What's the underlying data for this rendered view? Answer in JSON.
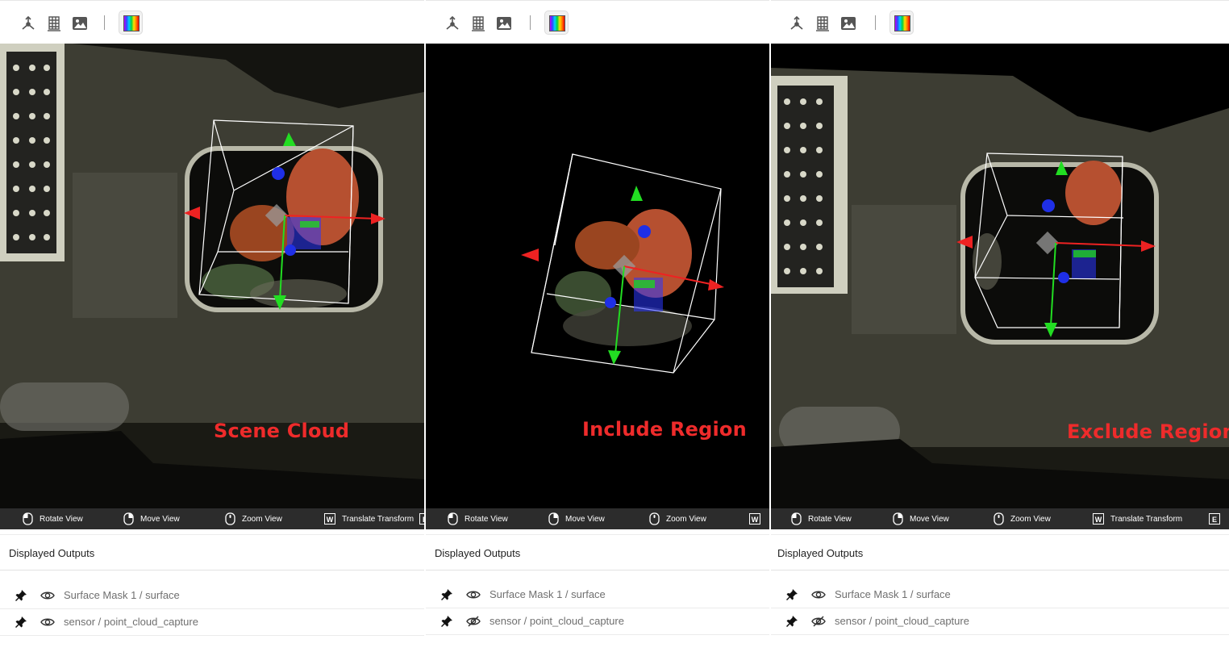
{
  "panels": [
    {
      "id": "scene",
      "overlay_label": "Scene Cloud",
      "toolbar": {
        "icons": [
          "axes-icon",
          "grid-icon",
          "image-icon",
          "colormap-icon"
        ]
      },
      "hints": [
        {
          "icon": "mouse-left-icon",
          "label": "Rotate View"
        },
        {
          "icon": "mouse-right-icon",
          "label": "Move View"
        },
        {
          "icon": "mouse-wheel-icon",
          "label": "Zoom View"
        },
        {
          "key": "W",
          "label": "Translate Transform"
        },
        {
          "key": "E",
          "label": ""
        }
      ],
      "outputs": {
        "title": "Displayed Outputs",
        "rows": [
          {
            "label": "Surface Mask 1 / surface",
            "visible": true
          },
          {
            "label": "sensor / point_cloud_capture",
            "visible": true
          }
        ]
      }
    },
    {
      "id": "include",
      "overlay_label": "Include Region",
      "toolbar": {
        "icons": [
          "axes-icon",
          "grid-icon",
          "image-icon",
          "colormap-icon"
        ]
      },
      "hints": [
        {
          "icon": "mouse-left-icon",
          "label": "Rotate View"
        },
        {
          "icon": "mouse-right-icon",
          "label": "Move View"
        },
        {
          "icon": "mouse-wheel-icon",
          "label": "Zoom View"
        },
        {
          "key": "W",
          "label": ""
        }
      ],
      "outputs": {
        "title": "Displayed Outputs",
        "rows": [
          {
            "label": "Surface Mask 1 / surface",
            "visible": true
          },
          {
            "label": "sensor / point_cloud_capture",
            "visible": false
          }
        ]
      }
    },
    {
      "id": "exclude",
      "overlay_label": "Exclude Region",
      "toolbar": {
        "icons": [
          "axes-icon",
          "grid-icon",
          "image-icon",
          "colormap-icon"
        ]
      },
      "hints": [
        {
          "icon": "mouse-left-icon",
          "label": "Rotate View"
        },
        {
          "icon": "mouse-right-icon",
          "label": "Move View"
        },
        {
          "icon": "mouse-wheel-icon",
          "label": "Zoom View"
        },
        {
          "key": "W",
          "label": "Translate Transform"
        },
        {
          "key": "E",
          "label": ""
        }
      ],
      "outputs": {
        "title": "Displayed Outputs",
        "rows": [
          {
            "label": "Surface Mask 1 / surface",
            "visible": true
          },
          {
            "label": "sensor / point_cloud_capture",
            "visible": false
          }
        ]
      }
    }
  ],
  "colors": {
    "overlay_label": "#ee2b2b",
    "viewport_bg": "#000000",
    "hintbar_bg": "#2c2c2c",
    "gizmo_x": "#ee2222",
    "gizmo_y": "#22dd22",
    "gizmo_z": "#1f2fe6",
    "bbox": "#ffffff"
  }
}
